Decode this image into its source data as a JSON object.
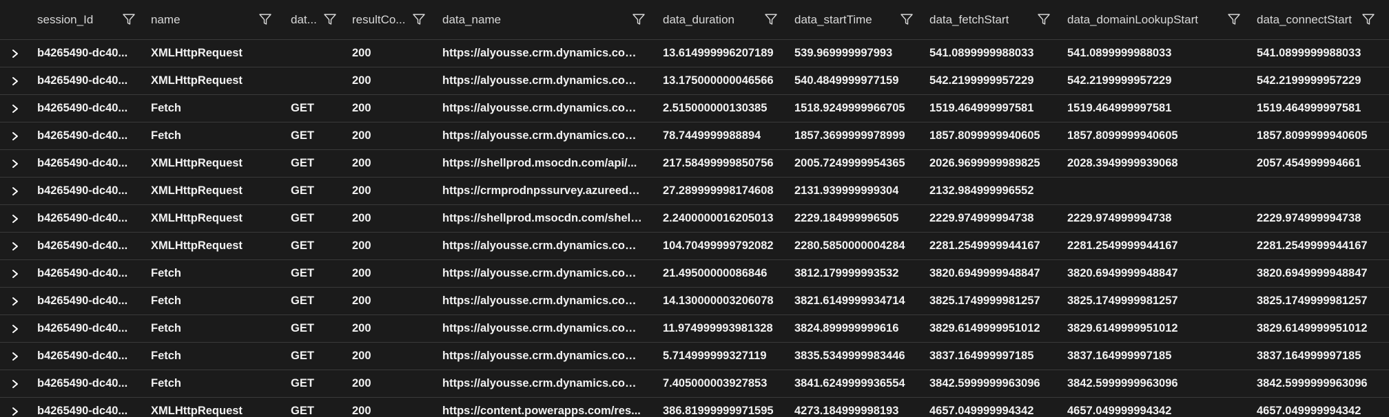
{
  "columns": [
    {
      "label": "session_Id"
    },
    {
      "label": "name"
    },
    {
      "label": "dat..."
    },
    {
      "label": "resultCo..."
    },
    {
      "label": "data_name"
    },
    {
      "label": "data_duration"
    },
    {
      "label": "data_startTime"
    },
    {
      "label": "data_fetchStart"
    },
    {
      "label": "data_domainLookupStart"
    },
    {
      "label": "data_connectStart"
    }
  ],
  "rows": [
    [
      "b4265490-dc40...",
      "XMLHttpRequest",
      "",
      "200",
      "https://alyousse.crm.dynamics.com/...",
      "13.614999996207189",
      "539.969999997993",
      "541.0899999988033",
      "541.0899999988033",
      "541.0899999988033"
    ],
    [
      "b4265490-dc40...",
      "XMLHttpRequest",
      "",
      "200",
      "https://alyousse.crm.dynamics.com/...",
      "13.175000000046566",
      "540.4849999977159",
      "542.2199999957229",
      "542.2199999957229",
      "542.2199999957229"
    ],
    [
      "b4265490-dc40...",
      "Fetch",
      "GET",
      "200",
      "https://alyousse.crm.dynamics.com/...",
      "2.515000000130385",
      "1518.9249999966705",
      "1519.464999997581",
      "1519.464999997581",
      "1519.464999997581"
    ],
    [
      "b4265490-dc40...",
      "Fetch",
      "GET",
      "200",
      "https://alyousse.crm.dynamics.com/...",
      "78.7449999988894",
      "1857.3699999978999",
      "1857.8099999940605",
      "1857.8099999940605",
      "1857.8099999940605"
    ],
    [
      "b4265490-dc40...",
      "XMLHttpRequest",
      "GET",
      "200",
      "https://shellprod.msocdn.com/api/...",
      "217.58499999850756",
      "2005.7249999954365",
      "2026.9699999989825",
      "2028.3949999939068",
      "2057.454999994661"
    ],
    [
      "b4265490-dc40...",
      "XMLHttpRequest",
      "GET",
      "200",
      "https://crmprodnpssurvey.azureedg...",
      "27.289999998174608",
      "2131.939999999304",
      "2132.984999996552",
      "",
      ""
    ],
    [
      "b4265490-dc40...",
      "XMLHttpRequest",
      "GET",
      "200",
      "https://shellprod.msocdn.com/shell...",
      "2.2400000016205013",
      "2229.184999996505",
      "2229.974999994738",
      "2229.974999994738",
      "2229.974999994738"
    ],
    [
      "b4265490-dc40...",
      "XMLHttpRequest",
      "GET",
      "200",
      "https://alyousse.crm.dynamics.com/...",
      "104.70499999792082",
      "2280.5850000004284",
      "2281.2549999944167",
      "2281.2549999944167",
      "2281.2549999944167"
    ],
    [
      "b4265490-dc40...",
      "Fetch",
      "GET",
      "200",
      "https://alyousse.crm.dynamics.com/...",
      "21.49500000086846",
      "3812.179999993532",
      "3820.6949999948847",
      "3820.6949999948847",
      "3820.6949999948847"
    ],
    [
      "b4265490-dc40...",
      "Fetch",
      "GET",
      "200",
      "https://alyousse.crm.dynamics.com/...",
      "14.130000003206078",
      "3821.6149999934714",
      "3825.1749999981257",
      "3825.1749999981257",
      "3825.1749999981257"
    ],
    [
      "b4265490-dc40...",
      "Fetch",
      "GET",
      "200",
      "https://alyousse.crm.dynamics.com/...",
      "11.974999993981328",
      "3824.899999999616",
      "3829.6149999951012",
      "3829.6149999951012",
      "3829.6149999951012"
    ],
    [
      "b4265490-dc40...",
      "Fetch",
      "GET",
      "200",
      "https://alyousse.crm.dynamics.com/...",
      "5.714999999327119",
      "3835.5349999983446",
      "3837.164999997185",
      "3837.164999997185",
      "3837.164999997185"
    ],
    [
      "b4265490-dc40...",
      "Fetch",
      "GET",
      "200",
      "https://alyousse.crm.dynamics.com/...",
      "7.405000003927853",
      "3841.6249999936554",
      "3842.5999999963096",
      "3842.5999999963096",
      "3842.5999999963096"
    ],
    [
      "b4265490-dc40...",
      "XMLHttpRequest",
      "GET",
      "200",
      "https://content.powerapps.com/res...",
      "386.81999999971595",
      "4273.184999998193",
      "4657.049999994342",
      "4657.049999994342",
      "4657.049999994342"
    ]
  ],
  "icons": {
    "filter": "filter-icon",
    "expand": "chevron-right-icon"
  },
  "colors": {
    "background": "#1b1b1b",
    "text": "#ffffff",
    "row_border": "#3a3a3a",
    "header_text": "#d8d8d8"
  }
}
